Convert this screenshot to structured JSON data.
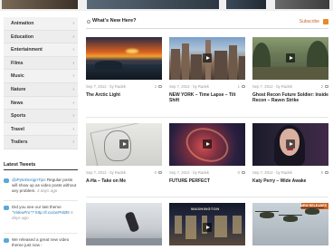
{
  "sidebar": {
    "categories": [
      {
        "label": "Animation"
      },
      {
        "label": "Education"
      },
      {
        "label": "Entertainment"
      },
      {
        "label": "Films"
      },
      {
        "label": "Music"
      },
      {
        "label": "Nature"
      },
      {
        "label": "News"
      },
      {
        "label": "Sports"
      },
      {
        "label": "Travel"
      },
      {
        "label": "Trailers"
      }
    ],
    "arrow_glyph": "›"
  },
  "tweets": {
    "title": "Latest Tweets",
    "items": [
      {
        "handle": "@iPyleDesignTips",
        "text": "Regular posts will show up as video posts without any problem.",
        "time": "3 days ago"
      },
      {
        "text": "Did you see our last theme",
        "link": "\"VideoPro\"?",
        "link2": "http://t.co/asPr6B5",
        "time": "5 days ago"
      },
      {
        "text": "We released a great new video theme just now -",
        "time": ""
      }
    ]
  },
  "main": {
    "section_title": "What's New Here?",
    "subscribe_label": "Subscribe",
    "cards": [
      {
        "date": "Sep 7, 2012",
        "author": "· by Radek",
        "comments": "2",
        "title": "The Arctic Light"
      },
      {
        "date": "Sep 7, 2012",
        "author": "· by Radek",
        "comments": "1",
        "title": "NEW YORK – Time Lapse – Tilt Shift"
      },
      {
        "date": "Sep 7, 2012",
        "author": "· by Radek",
        "comments": "2",
        "title": "Ghost Recon Future Soldier: Inside Recon – Raven Strike"
      },
      {
        "date": "Sep 7, 2012",
        "author": "· by Radek",
        "comments": "0",
        "title": "A-Ha – Take on Me"
      },
      {
        "date": "Sep 7, 2012",
        "author": "· by Radek",
        "comments": "0",
        "title": "FUTURE PERFECT"
      },
      {
        "date": "Sep 7, 2012",
        "author": "· by Radek",
        "comments": "8",
        "title": "Katy Perry – Wide Awake"
      }
    ],
    "row3_caption": "WASHINGTON",
    "row3_banner": "NEW RELEASES"
  },
  "colors": {
    "accent": "#c46a2a",
    "rss": "#e8892b",
    "tweet_icon": "#5aa8d8",
    "link": "#2a7ab8"
  },
  "icons": {
    "play": "play-icon",
    "comment": "comment-bubble-icon",
    "rss": "rss-icon",
    "twitter": "twitter-icon"
  }
}
